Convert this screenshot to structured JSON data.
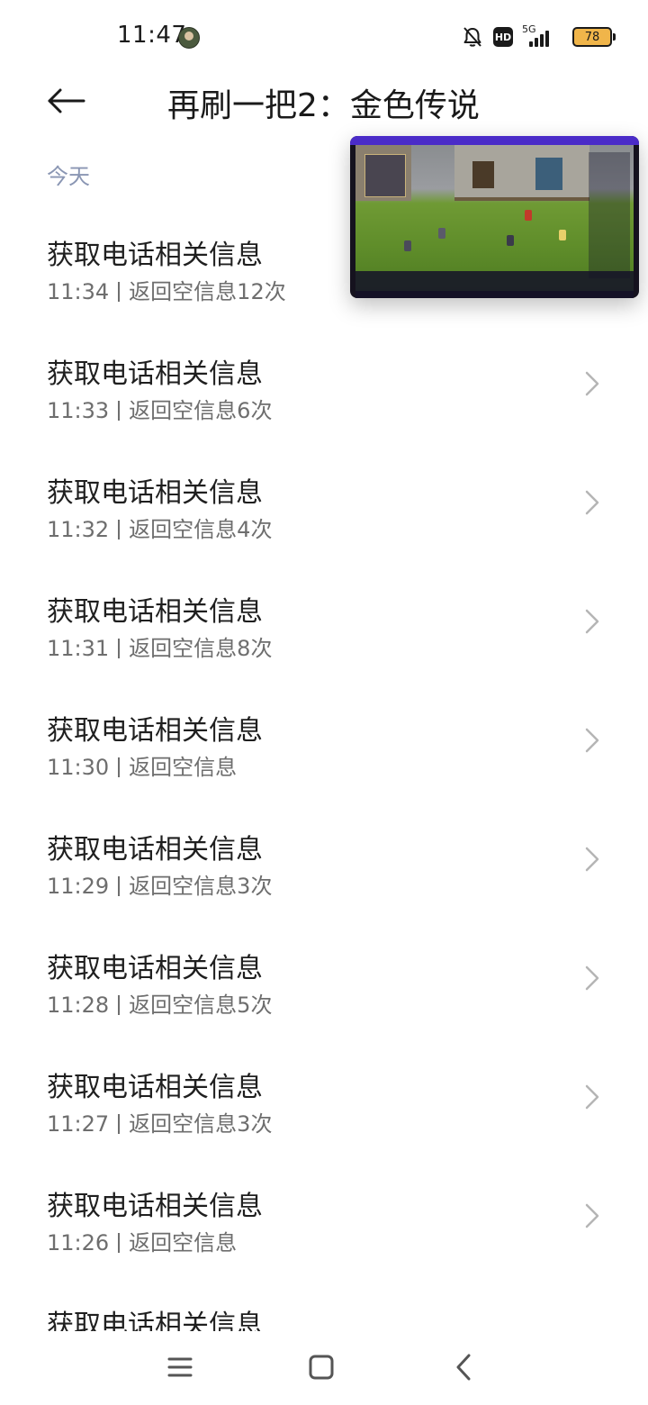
{
  "status_bar": {
    "time": "11:47",
    "network": "5G",
    "hd": "HD",
    "battery": "78"
  },
  "header": {
    "title": "再刷一把2：金色传说"
  },
  "section": {
    "label": "今天"
  },
  "items": [
    {
      "title": "获取电话相关信息",
      "time": "11:34",
      "result": "返回空信息12次"
    },
    {
      "title": "获取电话相关信息",
      "time": "11:33",
      "result": "返回空信息6次"
    },
    {
      "title": "获取电话相关信息",
      "time": "11:32",
      "result": "返回空信息4次"
    },
    {
      "title": "获取电话相关信息",
      "time": "11:31",
      "result": "返回空信息8次"
    },
    {
      "title": "获取电话相关信息",
      "time": "11:30",
      "result": "返回空信息"
    },
    {
      "title": "获取电话相关信息",
      "time": "11:29",
      "result": "返回空信息3次"
    },
    {
      "title": "获取电话相关信息",
      "time": "11:28",
      "result": "返回空信息5次"
    },
    {
      "title": "获取电话相关信息",
      "time": "11:27",
      "result": "返回空信息3次"
    },
    {
      "title": "获取电话相关信息",
      "time": "11:26",
      "result": "返回空信息"
    },
    {
      "title": "获取电话相关信息"
    }
  ],
  "icons": {
    "back": "arrow-left-icon",
    "chevron": "chevron-right-icon",
    "nav_menu": "menu-icon",
    "nav_home": "home-square-icon",
    "nav_back": "back-chevron-icon",
    "mute": "bell-off-icon"
  },
  "colors": {
    "section_label": "#8a96b3",
    "secondary_text": "#6e6e6e",
    "battery": "#f0b54a"
  }
}
